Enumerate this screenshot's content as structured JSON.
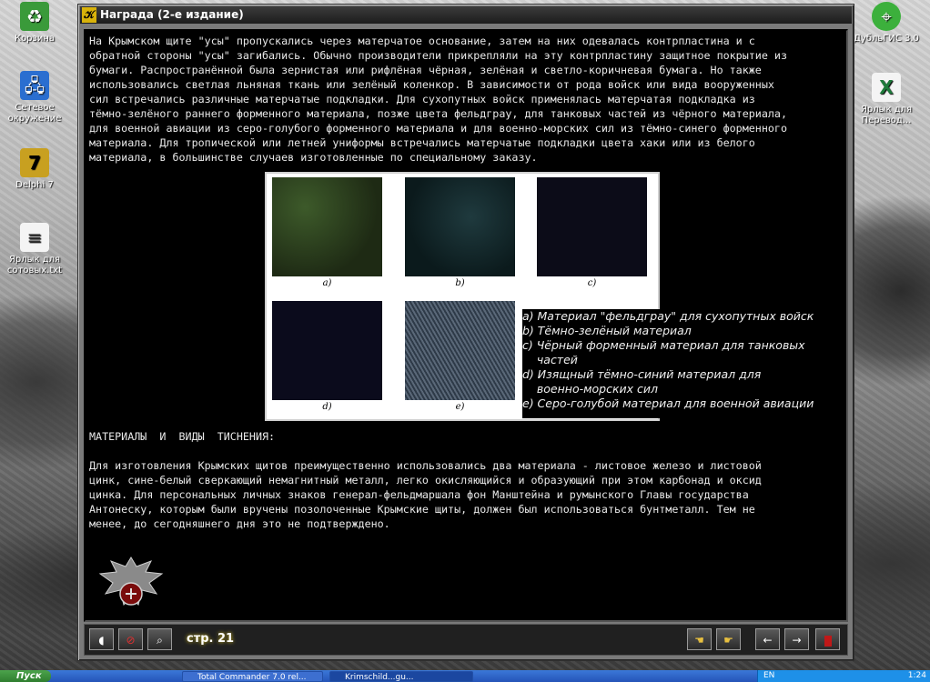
{
  "desktop": {
    "icons_left": [
      {
        "label": "Корзина",
        "icon": "recycle-bin-icon"
      },
      {
        "label": "Сетевое окружение",
        "icon": "network-icon"
      },
      {
        "label": "Delphi 7",
        "icon": "delphi-icon"
      },
      {
        "label": "Ярлык для сотовых.txt",
        "icon": "text-file-icon"
      }
    ],
    "icons_right": [
      {
        "label": "ДубльГИС 3.0",
        "icon": "dublgis-icon"
      },
      {
        "label": "Ярлык для Перевод...",
        "icon": "excel-file-icon"
      }
    ]
  },
  "window": {
    "title": "Награда (2-е издание)",
    "icon": "app-icon"
  },
  "content": {
    "intro_paragraph": "На Крымском щите \"усы\" пропускались через матерчатое основание, затем на них одевалась контрпластина и с\nобратной стороны \"усы\" загибались. Обычно производители прикрепляли на эту контрпластину защитное покрытие из\nбумаги. Распространённой была зернистая или рифлёная чёрная, зелёная и светло-коричневая бумага. Но также\nиспользовались светлая льняная ткань или зелёный коленкор. В зависимости от рода войск или вида вооруженных\nсил встречались различные матерчатые подкладки. Для сухопутных войск  применялась матерчатая подкладка из\nтёмно-зелёного раннего форменного материала, позже цвета фельдграу, для танковых частей из чёрного материала,\nдля военной авиации из серо-голубого форменного материала и для военно-морских сил из тёмно-синего форменного\nматериала. Для тропической или летней униформы встречались матерчатые подкладки цвета хаки или  из белого\nматериала, в большинстве случаев изготовленные по специальному заказу.",
    "figure": {
      "swatches": [
        {
          "label": "a)",
          "color": "#2b3a1e"
        },
        {
          "label": "b)",
          "color": "#0f2124"
        },
        {
          "label": "c)",
          "color": "#0c0c18"
        },
        {
          "label": "d)",
          "color": "#0b0b1c"
        },
        {
          "label": "e)",
          "color": "#4a5868"
        }
      ]
    },
    "legend": [
      "a) Материал \"фельдграу\"  для сухопутных войск",
      "b) Тёмно-зелёный материал",
      "c) Чёрный форменный материал для танковых",
      "    частей",
      "d) Изящный тёмно-синий материал для",
      "    военно-морских сил",
      "e) Серо-голубой материал для военной авиации"
    ],
    "section_heading": "МАТЕРИАЛЫ  И  ВИДЫ  ТИСНЕНИЯ:",
    "body_paragraph": "Для изготовления Крымских щитов преимущественно использовались два материала - листовое железо и листовой\nцинк, сине-белый сверкающий немагнитный металл, легко окисляющийся и образующий при этом карбонад и оксид\nцинка. Для персональных личных знаков генерал-фельдмаршала фон Манштейна и румынского Главы государства\nАнтонеску, которым были вручены позолоченные Крымские щиты, должен был использоваться бунтметалл. Тем не\nменее, до сегодняшнего дня это не подтверждено."
  },
  "toolbar": {
    "page_label": "стр. 21",
    "buttons_left": [
      "sound-icon",
      "no-sound-icon",
      "zoom-icon"
    ],
    "buttons_right": [
      "hand-back-icon",
      "hand-forward-icon",
      "arrow-left-icon",
      "arrow-right-icon",
      "exit-icon"
    ]
  },
  "taskbar": {
    "start_label": "Пуск",
    "tasks": [
      "Total Commander 7.0 rel...",
      "Krimschild...gu..."
    ],
    "clock": "1:24",
    "lang": "EN"
  }
}
